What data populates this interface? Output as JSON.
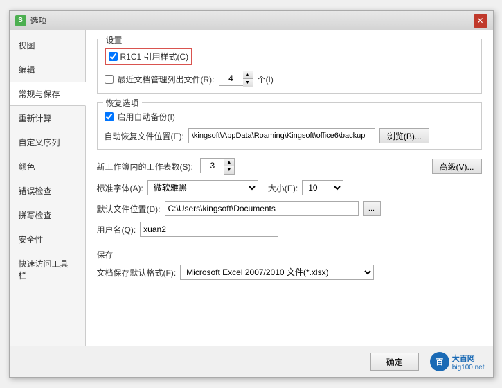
{
  "dialog": {
    "title": "选项",
    "icon": "S",
    "close_label": "✕"
  },
  "sidebar": {
    "items": [
      {
        "id": "view",
        "label": "视图",
        "active": false
      },
      {
        "id": "edit",
        "label": "编辑",
        "active": false
      },
      {
        "id": "general",
        "label": "常规与保存",
        "active": true
      },
      {
        "id": "recalc",
        "label": "重新计算",
        "active": false
      },
      {
        "id": "custom",
        "label": "自定义序列",
        "active": false
      },
      {
        "id": "color",
        "label": "颜色",
        "active": false
      },
      {
        "id": "error",
        "label": "错误检查",
        "active": false
      },
      {
        "id": "spell",
        "label": "拼写检查",
        "active": false
      },
      {
        "id": "security",
        "label": "安全性",
        "active": false
      },
      {
        "id": "quickbar",
        "label": "快速访问工具栏",
        "active": false
      }
    ]
  },
  "content": {
    "settings_section": {
      "title": "设置",
      "r1c1_checkbox": {
        "label": "R1C1 引用样式(C)",
        "checked": true,
        "highlighted": true
      },
      "recent_files_checkbox": {
        "label": "最近文档管理列出文件(R):",
        "checked": false
      },
      "recent_files_count": "4",
      "recent_files_unit": "个(I)"
    },
    "recovery_section": {
      "title": "恢复选项",
      "auto_backup_checkbox": {
        "label": "启用自动备份(I)",
        "checked": true
      },
      "auto_recover_label": "自动恢复文件位置(E):",
      "auto_recover_path": "\\kingsoft\\AppData\\Roaming\\Kingsoft\\office6\\backup",
      "browse_btn": "浏览(B)..."
    },
    "workbook_row": {
      "label": "新工作簿内的工作表数(S):",
      "value": "3",
      "advanced_btn": "高级(V)..."
    },
    "font_row": {
      "label": "标准字体(A):",
      "font_value": "微软雅黑",
      "size_label": "大小(E):",
      "size_value": "10"
    },
    "default_path_row": {
      "label": "默认文件位置(D):",
      "value": "C:\\Users\\kingsoft\\Documents",
      "browse_btn": "..."
    },
    "username_row": {
      "label": "用户名(Q):",
      "value": "xuan2"
    },
    "save_section": {
      "title": "保存",
      "format_label": "文档保存默认格式(F):",
      "format_value": "Microsoft Excel 2007/2010 文件(*.xlsx)"
    }
  },
  "footer": {
    "ok_btn": "确定",
    "brand_text": "大百网",
    "brand_sub": "big100.net"
  },
  "icons": {
    "spin_up": "▲",
    "spin_down": "▼",
    "dropdown": "▼",
    "checkbox_checked": "✓"
  }
}
